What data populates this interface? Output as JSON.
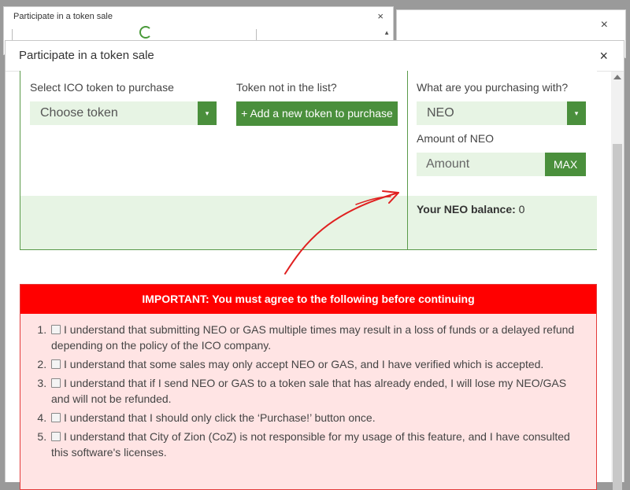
{
  "background_windows": {
    "window1_title": "Participate in a token sale",
    "window1_close": "×",
    "window2_close": "×"
  },
  "modal": {
    "title": "Participate in a token sale",
    "close": "×"
  },
  "token_select": {
    "label": "Select ICO token to purchase",
    "value": "Choose token",
    "caret": "▾"
  },
  "add_token": {
    "label": "Token not in the list?",
    "button_label": "+ Add a new token to purchase"
  },
  "purchase_with": {
    "label": "What are you purchasing with?",
    "value": "NEO",
    "caret": "▾"
  },
  "amount": {
    "label": "Amount of NEO",
    "placeholder": "Amount",
    "max_label": "MAX"
  },
  "balance": {
    "label": "Your NEO balance:",
    "value": "0"
  },
  "important": {
    "header": "IMPORTANT: You must agree to the following before continuing",
    "items": [
      "I understand that submitting NEO or GAS multiple times may result in a loss of funds or a delayed refund depending on the policy of the ICO company.",
      "I understand that some sales may only accept NEO or GAS, and I have verified which is accepted.",
      "I understand that if I send NEO or GAS to a token sale that has already ended, I will lose my NEO/GAS and will not be refunded.",
      "I understand that I should only click the ‘Purchase!’ button once.",
      "I understand that City of Zion (CoZ) is not responsible for my usage of this feature, and I have consulted this software's licenses."
    ]
  },
  "colors": {
    "brand_green": "#4a8f3c",
    "light_green": "#e7f4e4",
    "alert_red": "#ff0000",
    "alert_bg": "#ffe4e4",
    "annotation_arrow": "#e02020"
  }
}
